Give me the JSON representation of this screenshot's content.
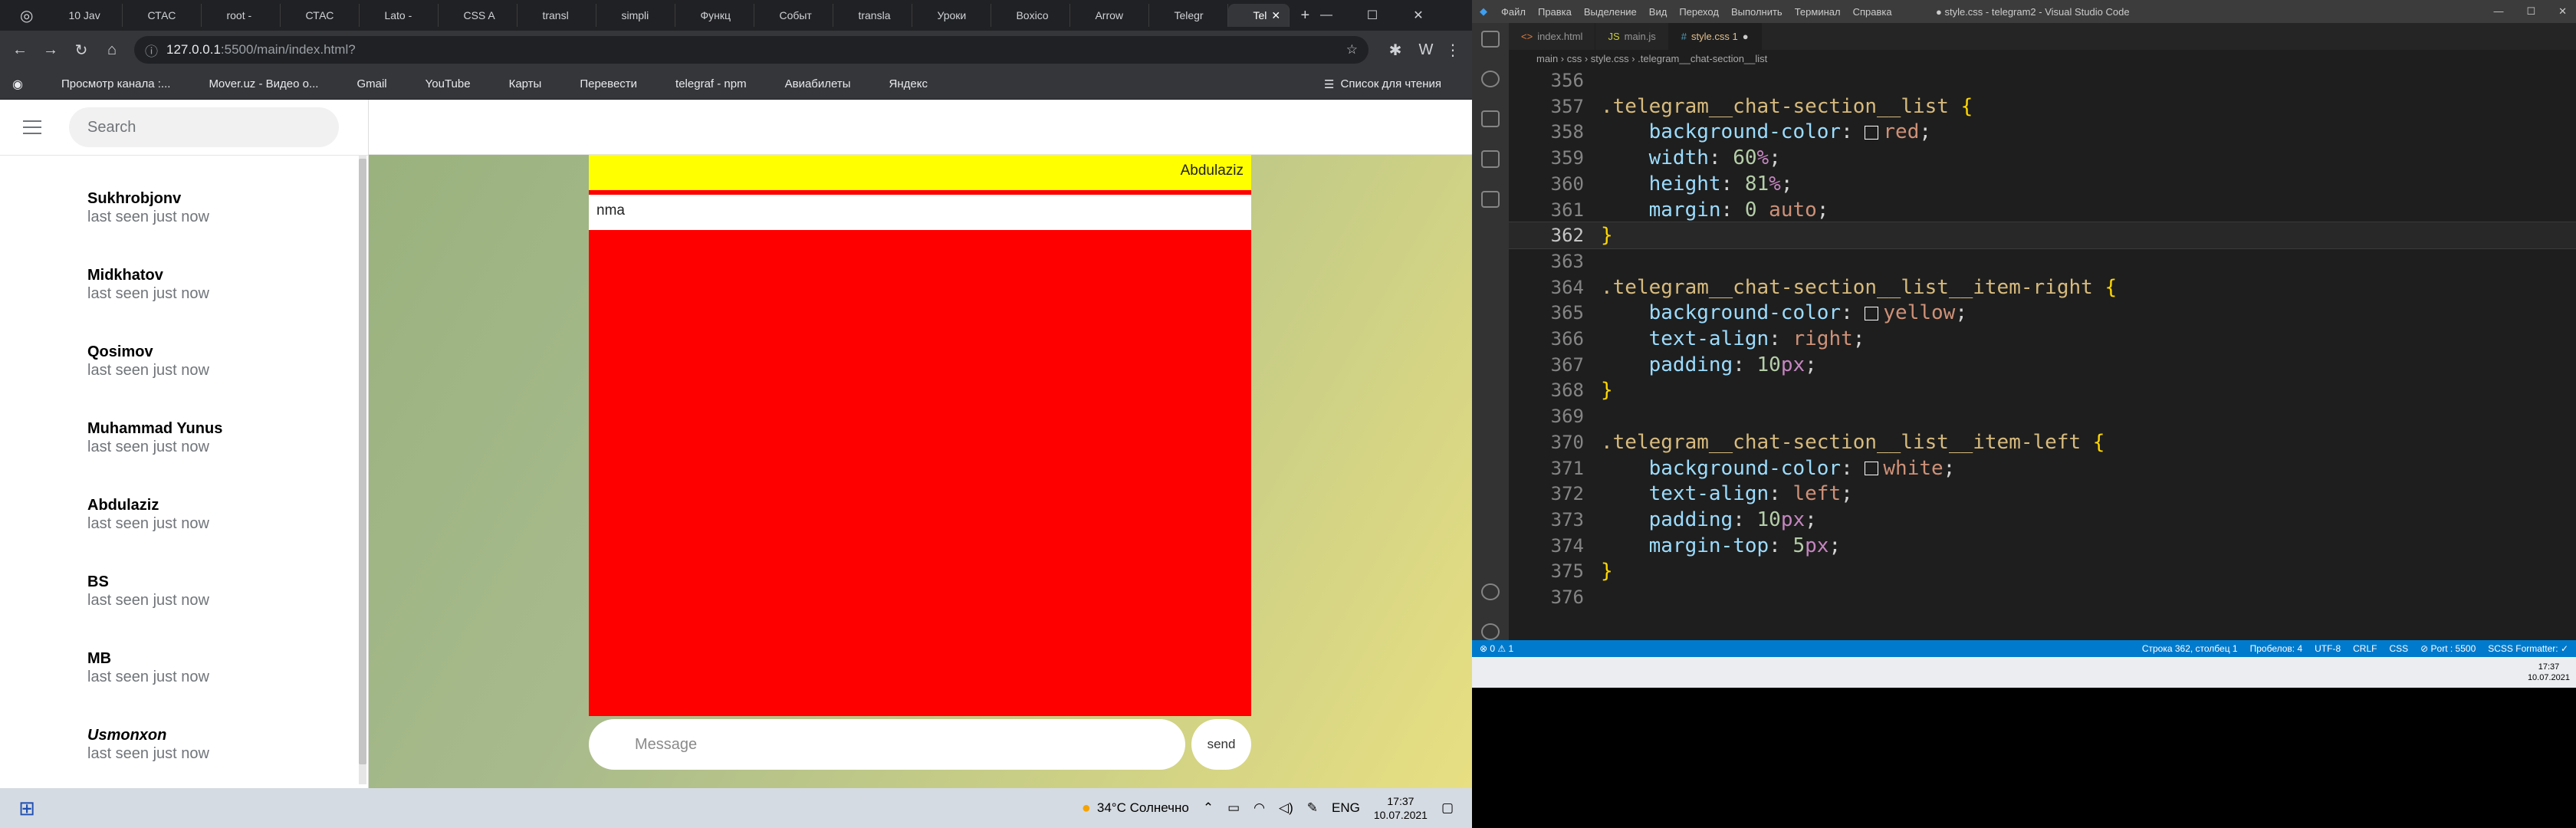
{
  "browser": {
    "tabs": [
      {
        "label": "10 Jav",
        "color": "#ffffff"
      },
      {
        "label": "СТАС",
        "color": "#ff0000"
      },
      {
        "label": "root -",
        "color": "#ffffff"
      },
      {
        "label": "СТАС",
        "color": "#ff0000"
      },
      {
        "label": "Lato -",
        "color": "#4285f4"
      },
      {
        "label": "CSS A",
        "color": "#1a73e8"
      },
      {
        "label": "transl",
        "color": "#ffffff"
      },
      {
        "label": "simpli",
        "color": "#ffffff"
      },
      {
        "label": "Функц",
        "color": "#ff0000"
      },
      {
        "label": "Событ",
        "color": "#ffffff"
      },
      {
        "label": "transla",
        "color": "#ffffff"
      },
      {
        "label": "Уроки",
        "color": "#ff0000"
      },
      {
        "label": "Boxico",
        "color": "#ff4081"
      },
      {
        "label": "Arrow",
        "color": "#00bfa5"
      },
      {
        "label": "Telegr",
        "color": "#2aa3ef"
      },
      {
        "label": "Tel",
        "color": "#2aa3ef"
      }
    ],
    "new_tab": "+",
    "url_host": "127.0.0.1",
    "url_path": ":5500/main/index.html?",
    "bookmarks": [
      {
        "label": "Просмотр канала :...",
        "color": "#34a853"
      },
      {
        "label": "Mover.uz - Видео о...",
        "color": "#ff3d00"
      },
      {
        "label": "Gmail",
        "color": "#ea4335"
      },
      {
        "label": "YouTube",
        "color": "#ff0000"
      },
      {
        "label": "Карты",
        "color": "#34a853"
      },
      {
        "label": "Перевести",
        "color": "#4285f4"
      },
      {
        "label": "telegraf - npm",
        "color": "#cb3837"
      },
      {
        "label": "Авиабилеты",
        "color": "#ffffff"
      },
      {
        "label": "Яндекс",
        "color": "#ffffff"
      }
    ],
    "reading_list": "Список для чтения"
  },
  "telegram": {
    "search_placeholder": "Search",
    "contacts": [
      {
        "name": "Sukhrobjonv",
        "status": "last seen just now",
        "color": "#222222"
      },
      {
        "name": "Midkhatov",
        "status": "last seen just now",
        "color": "#b23a48"
      },
      {
        "name": "Qosimov",
        "status": "last seen just now",
        "color": "#9aa7b0"
      },
      {
        "name": "Muhammad Yunus",
        "status": "last seen just now",
        "color": "#7e8f86"
      },
      {
        "name": "Abdulaziz",
        "status": "last seen just now",
        "color": "#5b4a40"
      },
      {
        "name": "BS",
        "status": "last seen just now",
        "color": "#b59a77"
      },
      {
        "name": "MB",
        "status": "last seen just now",
        "color": "#111111"
      },
      {
        "name": "Usmonxon",
        "status": "last seen just now",
        "color": "#3c2d20"
      }
    ],
    "chat": {
      "item_right": "Abdulaziz",
      "item_left": "nma",
      "message_placeholder": "Message",
      "send_label": "send"
    }
  },
  "left_taskbar": {
    "weather": "34°C Солнечно",
    "lang": "ENG",
    "time": "17:37",
    "date": "10.07.2021",
    "apps": [
      "#f0b400",
      "#1f4fb0",
      "#e8742b",
      "#9aa7b5",
      "#f2c000",
      "#34a853",
      "#0f9d9a",
      "#1e88e5"
    ]
  },
  "vscode": {
    "menu": [
      "Файл",
      "Правка",
      "Выделение",
      "Вид",
      "Переход",
      "Выполнить",
      "Терминал",
      "Справка"
    ],
    "window_title": "● style.css - telegram2 - Visual Studio Code",
    "tabs": [
      "index.html",
      "main.js",
      "style.css  1"
    ],
    "breadcrumb": "main › css › style.css › .telegram__chat-section__list",
    "lines": [
      {
        "n": "356",
        "tokens": []
      },
      {
        "n": "357",
        "tokens": [
          [
            "sel",
            ".telegram__chat-section__list "
          ],
          [
            "br",
            "{"
          ]
        ]
      },
      {
        "n": "358",
        "tokens": [
          [
            "pun",
            "    "
          ],
          [
            "prop",
            "background-color"
          ],
          [
            "pun",
            ": "
          ],
          [
            "sw",
            "#ff0000"
          ],
          [
            "val",
            "red"
          ],
          [
            "pun",
            ";"
          ]
        ]
      },
      {
        "n": "359",
        "tokens": [
          [
            "pun",
            "    "
          ],
          [
            "prop",
            "width"
          ],
          [
            "pun",
            ": "
          ],
          [
            "num2",
            "60"
          ],
          [
            "unit",
            "%"
          ],
          [
            "pun",
            ";"
          ]
        ]
      },
      {
        "n": "360",
        "tokens": [
          [
            "pun",
            "    "
          ],
          [
            "prop",
            "height"
          ],
          [
            "pun",
            ": "
          ],
          [
            "num2",
            "81"
          ],
          [
            "unit",
            "%"
          ],
          [
            "pun",
            ";"
          ]
        ]
      },
      {
        "n": "361",
        "tokens": [
          [
            "pun",
            "    "
          ],
          [
            "prop",
            "margin"
          ],
          [
            "pun",
            ": "
          ],
          [
            "num2",
            "0"
          ],
          [
            "pun",
            " "
          ],
          [
            "val",
            "auto"
          ],
          [
            "pun",
            ";"
          ]
        ]
      },
      {
        "n": "362",
        "tokens": [
          [
            "br",
            "}"
          ]
        ],
        "current": true
      },
      {
        "n": "363",
        "tokens": []
      },
      {
        "n": "364",
        "tokens": [
          [
            "sel",
            ".telegram__chat-section__list__item-right "
          ],
          [
            "br",
            "{"
          ]
        ]
      },
      {
        "n": "365",
        "tokens": [
          [
            "pun",
            "    "
          ],
          [
            "prop",
            "background-color"
          ],
          [
            "pun",
            ": "
          ],
          [
            "sw",
            "#ffff00"
          ],
          [
            "val",
            "yellow"
          ],
          [
            "pun",
            ";"
          ]
        ]
      },
      {
        "n": "366",
        "tokens": [
          [
            "pun",
            "    "
          ],
          [
            "prop",
            "text-align"
          ],
          [
            "pun",
            ": "
          ],
          [
            "val",
            "right"
          ],
          [
            "pun",
            ";"
          ]
        ]
      },
      {
        "n": "367",
        "tokens": [
          [
            "pun",
            "    "
          ],
          [
            "prop",
            "padding"
          ],
          [
            "pun",
            ": "
          ],
          [
            "num2",
            "10"
          ],
          [
            "unit",
            "px"
          ],
          [
            "pun",
            ";"
          ]
        ]
      },
      {
        "n": "368",
        "tokens": [
          [
            "br",
            "}"
          ]
        ]
      },
      {
        "n": "369",
        "tokens": []
      },
      {
        "n": "370",
        "tokens": [
          [
            "sel",
            ".telegram__chat-section__list__item-left "
          ],
          [
            "br",
            "{"
          ]
        ]
      },
      {
        "n": "371",
        "tokens": [
          [
            "pun",
            "    "
          ],
          [
            "prop",
            "background-color"
          ],
          [
            "pun",
            ": "
          ],
          [
            "sw",
            "#ffffff"
          ],
          [
            "val",
            "white"
          ],
          [
            "pun",
            ";"
          ]
        ]
      },
      {
        "n": "372",
        "tokens": [
          [
            "pun",
            "    "
          ],
          [
            "prop",
            "text-align"
          ],
          [
            "pun",
            ": "
          ],
          [
            "val",
            "left"
          ],
          [
            "pun",
            ";"
          ]
        ]
      },
      {
        "n": "373",
        "tokens": [
          [
            "pun",
            "    "
          ],
          [
            "prop",
            "padding"
          ],
          [
            "pun",
            ": "
          ],
          [
            "num2",
            "10"
          ],
          [
            "unit",
            "px"
          ],
          [
            "pun",
            ";"
          ]
        ]
      },
      {
        "n": "374",
        "tokens": [
          [
            "pun",
            "    "
          ],
          [
            "prop",
            "margin-top"
          ],
          [
            "pun",
            ": "
          ],
          [
            "num2",
            "5"
          ],
          [
            "unit",
            "px"
          ],
          [
            "pun",
            ";"
          ]
        ]
      },
      {
        "n": "375",
        "tokens": [
          [
            "br",
            "}"
          ]
        ]
      },
      {
        "n": "376",
        "tokens": []
      }
    ],
    "status_left": "⊗ 0 ⚠ 1",
    "status_right": [
      "Строка 362, столбец 1",
      "Пробелов: 4",
      "UTF-8",
      "CRLF",
      "CSS",
      "⊘ Port : 5500",
      "SCSS Formatter: ✓"
    ],
    "task_time": "17:37",
    "task_date": "10.07.2021",
    "task_apps": [
      "#0078d7",
      "#f0b400",
      "#1f4fb0",
      "#e8742b",
      "#9aa7b5",
      "#f2c000",
      "#34a853",
      "#0f9d9a",
      "#1e88e5"
    ]
  }
}
